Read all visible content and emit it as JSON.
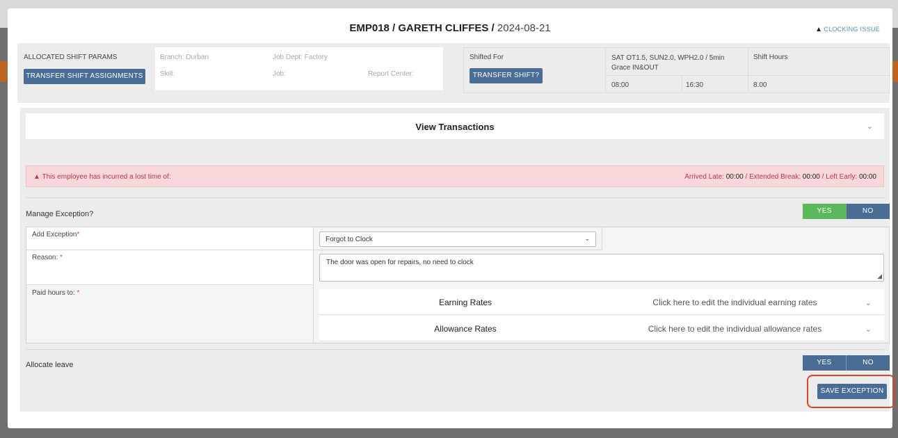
{
  "modal": {
    "employee": "EMP018 / GARETH CLIFFES /",
    "date": "2024-08-21",
    "clocking_issue": "CLOCKING ISSUE"
  },
  "params": {
    "allocated_label": "ALLOCATED SHIFT PARAMS",
    "transfer_assignments": "TRANSFER SHIFT ASSIGNMENTS",
    "branch": "Branch: Durban",
    "job_dept": "Job Dept: Factory",
    "skill": "Skill:",
    "job": "Job:",
    "report_center": "Report Center:",
    "shifted_for": "Shifted For",
    "transfer_shift": "TRANSFER SHIFT?",
    "shift_rules": "SAT OT1.5, SUN2.0, WPH2.0 / 5min Grace IN&OUT",
    "start": "08:00",
    "end": "16:30",
    "shift_hours_label": "Shift Hours",
    "shift_hours": "8.00"
  },
  "transactions": {
    "label": "View Transactions"
  },
  "alert": {
    "message": "This employee has incurred a lost time of:",
    "late_label": "Arrived Late:",
    "late": "00:00",
    "break_label": "/ Extended Break:",
    "break": "00:00",
    "early_label": "/ Left Early:",
    "early": "00:00"
  },
  "manage": {
    "label": "Manage Exception?",
    "yes": "YES",
    "no": "NO"
  },
  "form": {
    "add_exception": "Add Exception",
    "exception_value": "Forgot to Clock",
    "reason": "Reason:",
    "reason_value": "The door was open for repairs, no need to clock",
    "paid_hours": "Paid hours to:",
    "req": "*",
    "earning": {
      "name": "Earning Rates",
      "hint": "Click here to edit the individual earning rates"
    },
    "allowance": {
      "name": "Allowance Rates",
      "hint": "Click here to edit the individual allowance rates"
    }
  },
  "leave": {
    "label": "Allocate leave",
    "yes": "YES",
    "no": "NO"
  },
  "save": {
    "label": "SAVE EXCEPTION"
  },
  "icons": {
    "warning": "warning-icon",
    "chevron": "chevron-down-icon"
  },
  "colors": {
    "primary": "#4a6d96",
    "success": "#5cb85c",
    "alert_bg": "#f8d7da",
    "highlight": "#e0412b"
  }
}
